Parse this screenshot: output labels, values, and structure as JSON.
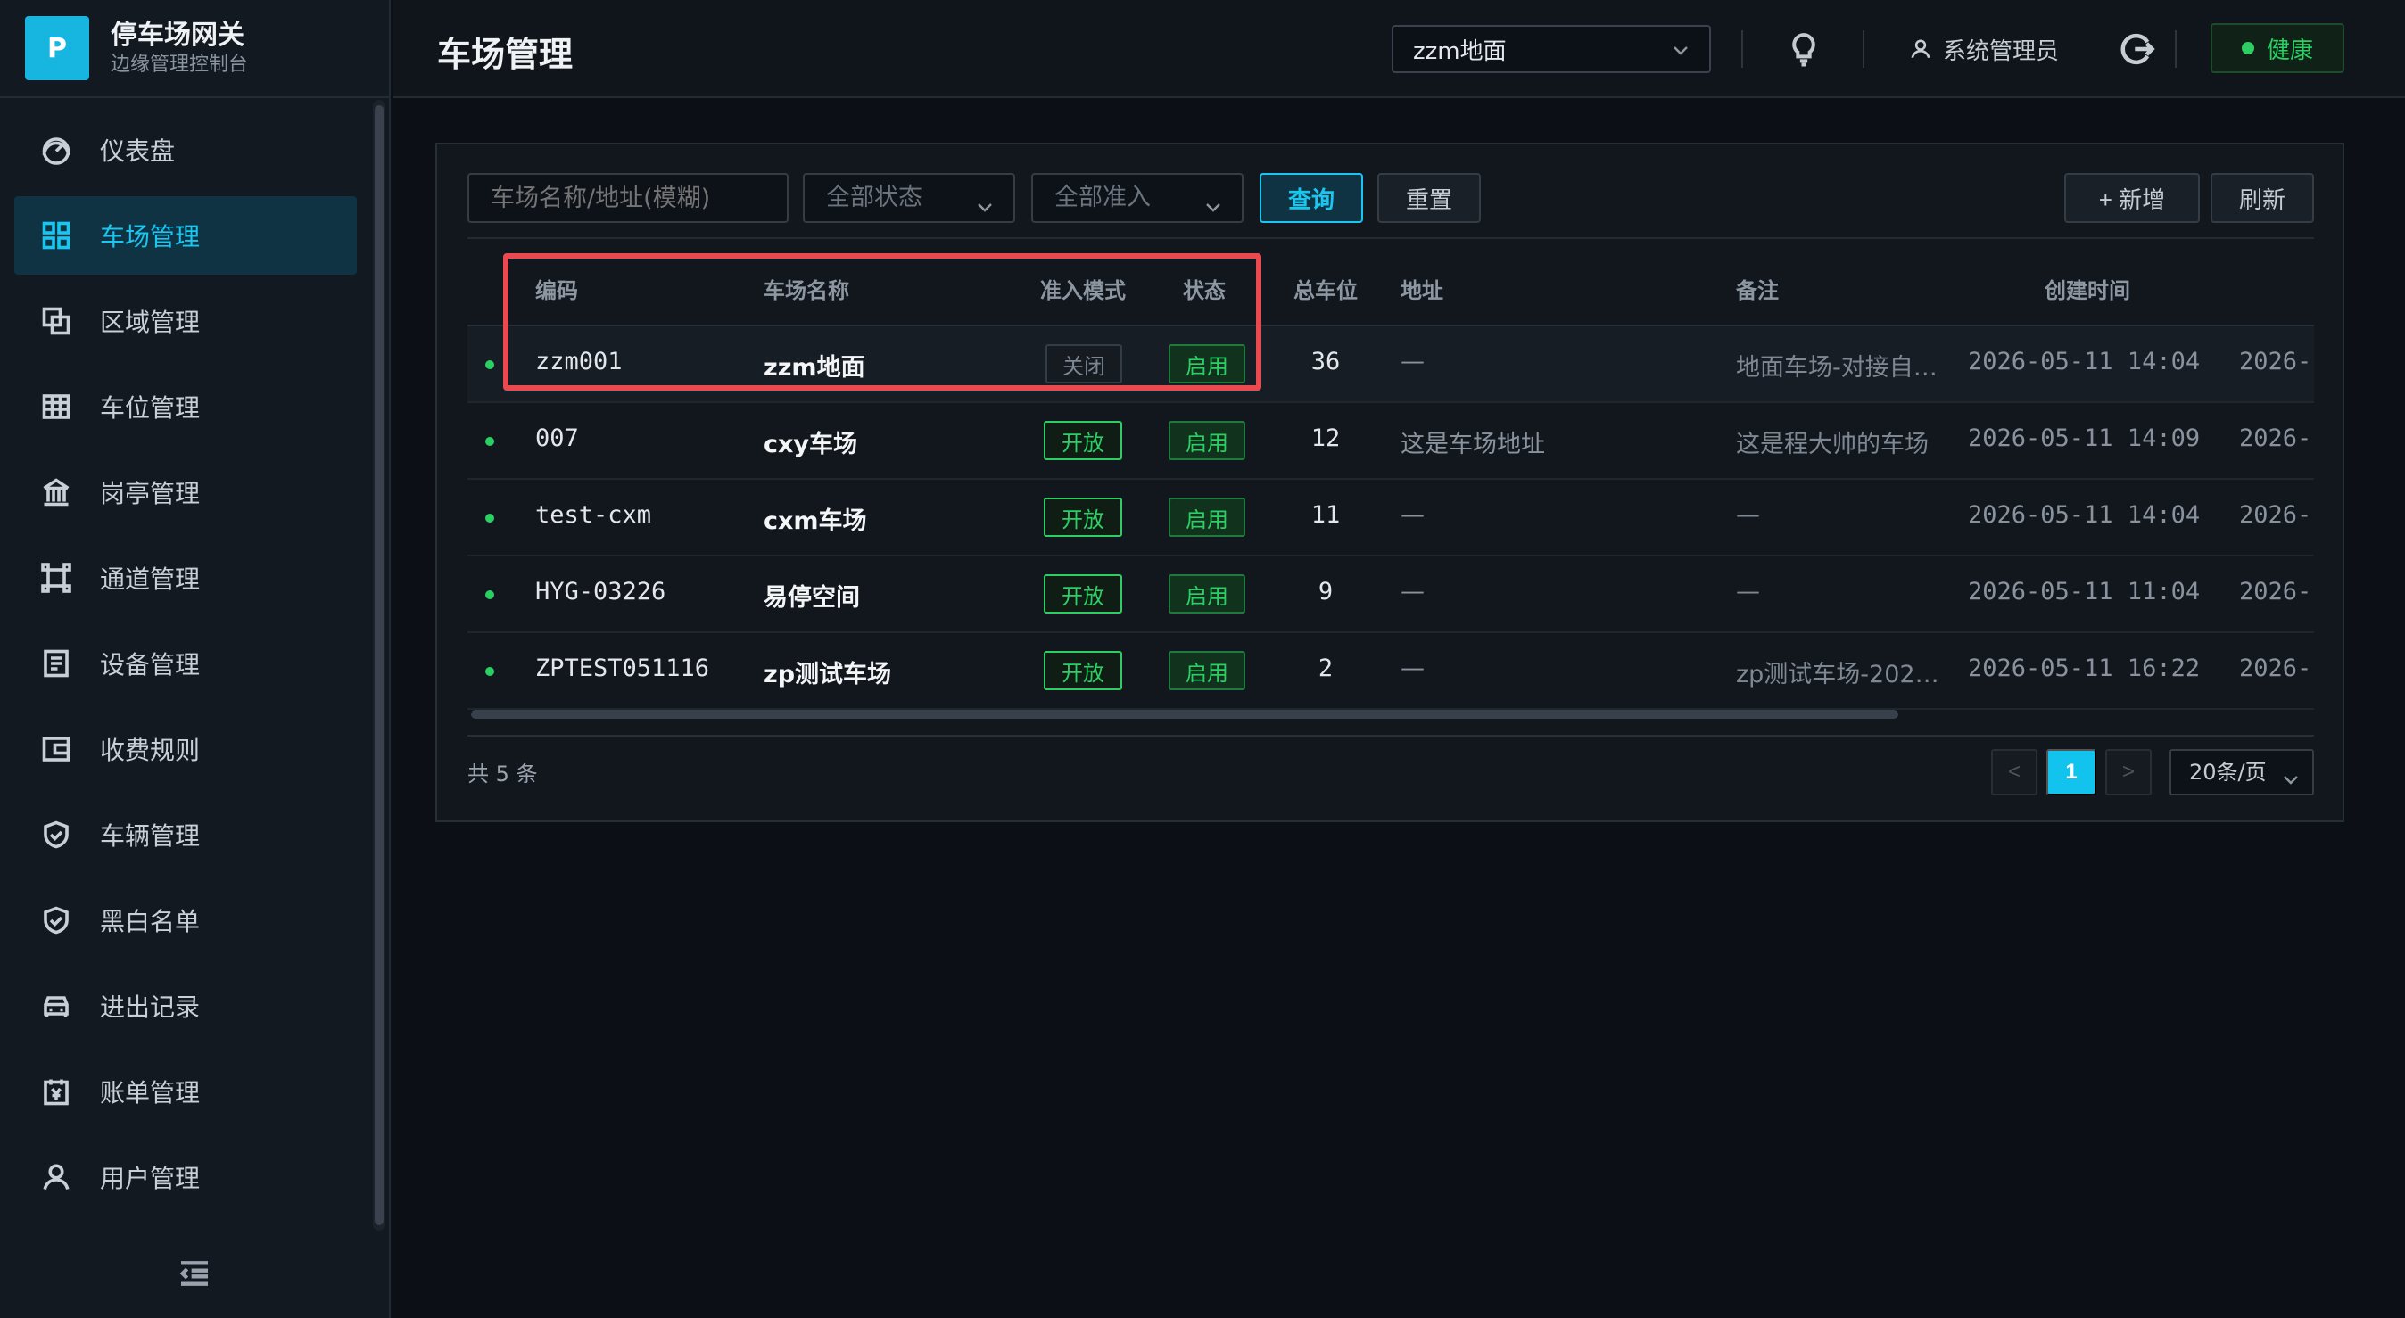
{
  "brand": {
    "logo": "P",
    "title": "停车场网关",
    "subtitle": "边缘管理控制台"
  },
  "sidebar": {
    "items": [
      {
        "label": "仪表盘",
        "icon": "dashboard-icon"
      },
      {
        "label": "车场管理",
        "icon": "grid-icon",
        "active": true
      },
      {
        "label": "区域管理",
        "icon": "layers-icon"
      },
      {
        "label": "车位管理",
        "icon": "table-icon"
      },
      {
        "label": "岗亭管理",
        "icon": "building-icon"
      },
      {
        "label": "通道管理",
        "icon": "channel-icon"
      },
      {
        "label": "设备管理",
        "icon": "device-icon"
      },
      {
        "label": "收费规则",
        "icon": "wallet-icon"
      },
      {
        "label": "车辆管理",
        "icon": "shield-icon"
      },
      {
        "label": "黑白名单",
        "icon": "shield-check-icon"
      },
      {
        "label": "进出记录",
        "icon": "car-icon"
      },
      {
        "label": "账单管理",
        "icon": "bill-icon"
      },
      {
        "label": "用户管理",
        "icon": "user-icon"
      }
    ]
  },
  "header": {
    "title": "车场管理",
    "lot_selector": "zzm地面",
    "user": "系统管理员",
    "health": "健康",
    "health_color": "#2ccf63"
  },
  "toolbar": {
    "search_placeholder": "车场名称/地址(模糊)",
    "status_filter": "全部状态",
    "access_filter": "全部准入",
    "query": "查询",
    "reset": "重置",
    "add": "+ 新增",
    "refresh": "刷新"
  },
  "table": {
    "columns": {
      "code": "编码",
      "name": "车场名称",
      "access": "准入模式",
      "status": "状态",
      "total": "总车位",
      "address": "地址",
      "note": "备注",
      "created": "创建时间"
    },
    "rows": [
      {
        "code": "zzm001",
        "name": "zzm地面",
        "access": "关闭",
        "access_open": false,
        "status": "启用",
        "total": "36",
        "address": "—",
        "note": "地面车场-对接自…",
        "created": "2026-05-11 14:04",
        "updated": "2026-"
      },
      {
        "code": "007",
        "name": "cxy车场",
        "access": "开放",
        "access_open": true,
        "status": "启用",
        "total": "12",
        "address": "这是车场地址",
        "note": "这是程大帅的车场",
        "created": "2026-05-11 14:09",
        "updated": "2026-"
      },
      {
        "code": "test-cxm",
        "name": "cxm车场",
        "access": "开放",
        "access_open": true,
        "status": "启用",
        "total": "11",
        "address": "—",
        "note": "—",
        "created": "2026-05-11 14:04",
        "updated": "2026-"
      },
      {
        "code": "HYG-03226",
        "name": "易停空间",
        "access": "开放",
        "access_open": true,
        "status": "启用",
        "total": "9",
        "address": "—",
        "note": "—",
        "created": "2026-05-11 11:04",
        "updated": "2026-"
      },
      {
        "code": "ZPTEST051116",
        "name": "zp测试车场",
        "access": "开放",
        "access_open": true,
        "status": "启用",
        "total": "2",
        "address": "—",
        "note": "zp测试车场-202…",
        "created": "2026-05-11 16:22",
        "updated": "2026-"
      }
    ]
  },
  "pagination": {
    "total": "共 5 条",
    "prev": "<",
    "current": "1",
    "next": ">",
    "page_size": "20条/页"
  },
  "colors": {
    "accent": "#19c6f0",
    "success": "#2ccf63",
    "highlight": "#e84a4f"
  }
}
